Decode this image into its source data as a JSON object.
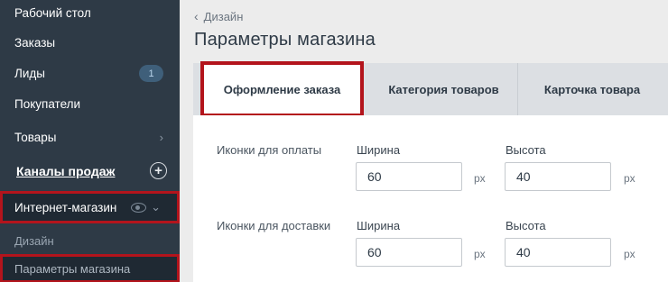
{
  "sidebar": {
    "items": [
      {
        "label": "Рабочий стол"
      },
      {
        "label": "Заказы"
      },
      {
        "label": "Лиды",
        "badge": "1"
      },
      {
        "label": "Покупатели"
      },
      {
        "label": "Товары"
      }
    ],
    "section_label": "Каналы продаж",
    "shop_label": "Интернет-магазин",
    "sub_items": [
      {
        "label": "Дизайн"
      },
      {
        "label": "Параметры магазина"
      }
    ]
  },
  "breadcrumb": {
    "label": "Дизайн"
  },
  "page": {
    "title": "Параметры магазина"
  },
  "tabs": [
    {
      "label": "Оформление заказа",
      "active": true
    },
    {
      "label": "Категория товаров"
    },
    {
      "label": "Карточка товара"
    }
  ],
  "form": {
    "rows": [
      {
        "label": "Иконки для оплаты",
        "width_label": "Ширина",
        "width_value": "60",
        "height_label": "Высота",
        "height_value": "40",
        "unit": "px"
      },
      {
        "label": "Иконки для доставки",
        "width_label": "Ширина",
        "width_value": "60",
        "height_label": "Высота",
        "height_value": "40",
        "unit": "px"
      }
    ]
  },
  "colors": {
    "sidebar_bg": "#2e3a46",
    "highlight": "#b3141c",
    "badge_bg": "#3f5f7a"
  }
}
